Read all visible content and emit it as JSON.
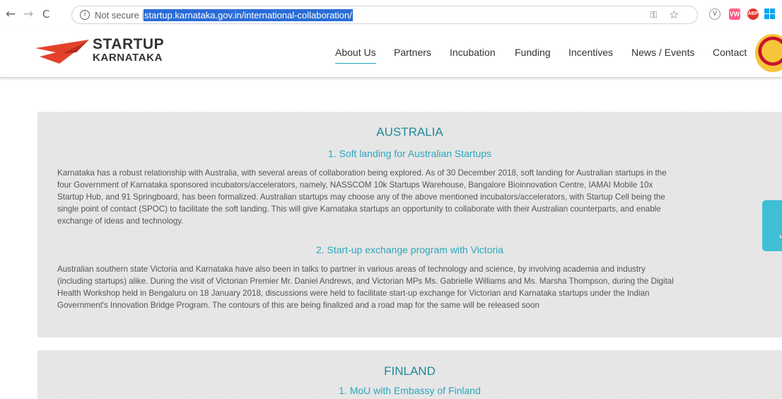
{
  "browser": {
    "back_icon": "←",
    "forward_icon": "→",
    "reload_icon": "C",
    "security_label": "Not secure",
    "separator": "|",
    "url": "startup.karnataka.gov.in/international-collaboration/",
    "extensions": [
      "V",
      "VW",
      "ABP"
    ]
  },
  "site": {
    "logo": {
      "line1": "STARTUP",
      "line2": "KARNATAKA"
    },
    "menu": [
      {
        "label": "About Us",
        "active": true
      },
      {
        "label": "Partners",
        "active": false
      },
      {
        "label": "Incubation",
        "active": false
      },
      {
        "label": "Funding",
        "active": false
      },
      {
        "label": "Incentives",
        "active": false
      },
      {
        "label": "News / Events",
        "active": false
      },
      {
        "label": "Contact",
        "active": false
      }
    ],
    "accent_color": "#1eaab8"
  },
  "sections": [
    {
      "country": "AUSTRALIA",
      "items": [
        {
          "heading": "1. Soft landing for Australian Startups",
          "lines": [
            "Karnataka has a robust relationship with Australia, with several areas of collaboration being explored. As of 30 December 2018, soft landing for Australian startups in the",
            "four Government of Karnataka sponsored incubators/accelerators, namely, NASSCOM 10k Startups Warehouse, Bangalore Bioinnovation Centre, IAMAI Mobile 10x",
            "Startup Hub, and 91 Springboard, has been formalized. Australian startups may choose any of the above mentioned incubators/accelerators, with Startup Cell being the",
            "single point of contact (SPOC) to facilitate the soft landing. This will give Karnataka startups an opportunity to collaborate with their Australian counterparts, and enable",
            "exchange of ideas and technology."
          ]
        },
        {
          "heading": "2. Start-up exchange program with Victoria",
          "lines": [
            "Australian southern state Victoria and Karnataka have also been in talks to partner in various areas of technology and science, by involving academia and industry",
            "(including startups) alike. During the visit of Victorian Premier Mr. Daniel Andrews, and Victorian MPs Ms. Gabrielle Williams and Ms. Marsha Thompson, during the Digital",
            "Health Workshop held in Bengaluru on 18 January 2018, discussions were held to facilitate start-up exchange for Victorian and Karnataka startups under the Indian",
            "Government's Innovation Bridge Program. The contours of this are being finalized and a road map for the same will be released soon"
          ]
        }
      ]
    },
    {
      "country": "FINLAND",
      "items": [
        {
          "heading": "1. MoU with Embassy of Finland",
          "lines": []
        }
      ]
    }
  ]
}
